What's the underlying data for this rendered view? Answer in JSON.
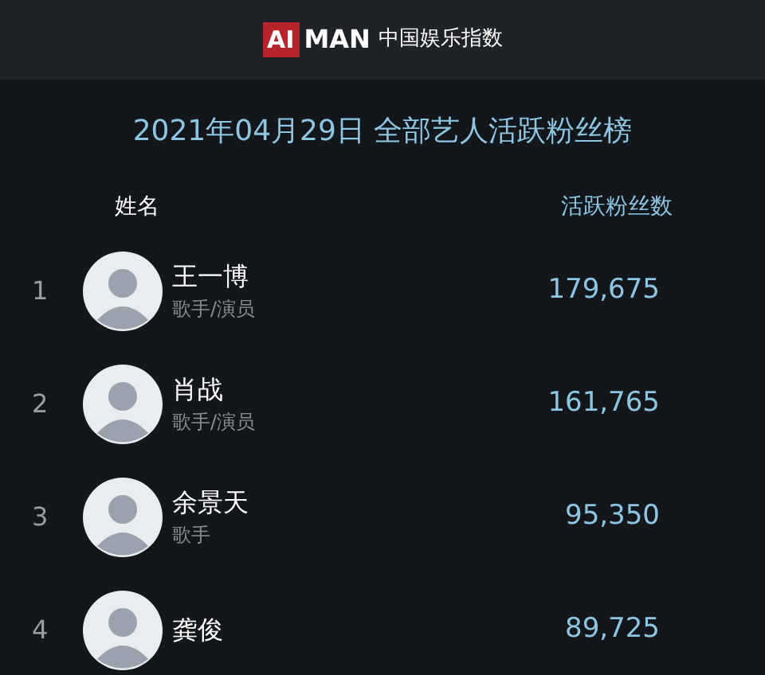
{
  "header": {
    "logo_badge": "AI",
    "logo_word": "MAN",
    "logo_tagline": "中国娱乐指数"
  },
  "title": "2021年04月29日 全部艺人活跃粉丝榜",
  "columns": [
    "姓名",
    "活跃粉丝数"
  ],
  "rows": [
    {
      "rank": "1",
      "name": "王一博",
      "role": "歌手/演员",
      "fans": "179,675"
    },
    {
      "rank": "2",
      "name": "肖战",
      "role": "歌手/演员",
      "fans": "161,765"
    },
    {
      "rank": "3",
      "name": "余景天",
      "role": "歌手",
      "fans": "95,350"
    },
    {
      "rank": "4",
      "name": "龚俊",
      "fans": "89,725"
    }
  ]
}
